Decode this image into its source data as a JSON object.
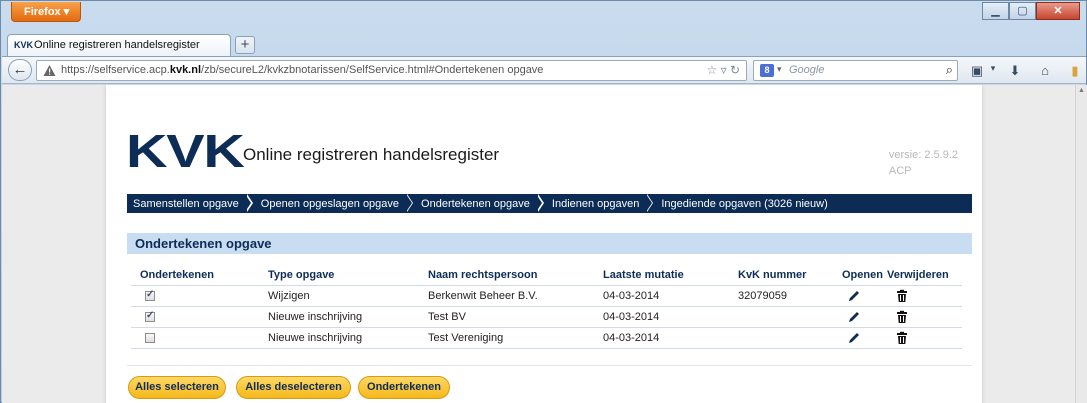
{
  "browser": {
    "app_button": "Firefox",
    "tab_title": "Online registreren handelsregister",
    "tab_favicon_text": "KVK",
    "url_prefix": "https://selfservice.acp.",
    "url_domain": "kvk.nl",
    "url_suffix": "/zb/secureL2/kvkzbnotarissen/SelfService.html#Ondertekenen opgave",
    "search_placeholder": "Google",
    "search_engine_letter": "8"
  },
  "header": {
    "logo": "KVK",
    "title": "Online registreren handelsregister",
    "version_line1": "versie: 2.5.9.2",
    "version_line2": "ACP"
  },
  "steps": [
    "Samenstellen opgave",
    "Openen opgeslagen opgave",
    "Ondertekenen opgave",
    "Indienen opgaven",
    "Ingediende opgaven (3026 nieuw)"
  ],
  "section": {
    "title": "Ondertekenen opgave"
  },
  "table": {
    "headers": [
      "Ondertekenen",
      "Type opgave",
      "Naam rechtspersoon",
      "Laatste mutatie",
      "KvK nummer",
      "Openen",
      "Verwijderen"
    ],
    "rows": [
      {
        "checked": true,
        "type": "Wijzigen",
        "name": "Berkenwit Beheer B.V.",
        "date": "04-03-2014",
        "kvk": "32079059"
      },
      {
        "checked": true,
        "type": "Nieuwe inschrijving",
        "name": "Test BV",
        "date": "04-03-2014",
        "kvk": ""
      },
      {
        "checked": false,
        "type": "Nieuwe inschrijving",
        "name": "Test Vereniging",
        "date": "04-03-2014",
        "kvk": ""
      }
    ]
  },
  "buttons": {
    "select_all": "Alles selecteren",
    "deselect_all": "Alles deselecteren",
    "sign": "Ondertekenen"
  },
  "colors": {
    "brand_navy": "#0d2d57",
    "section_bg": "#c8dcf2",
    "button_yellow": "#f5b81a"
  }
}
